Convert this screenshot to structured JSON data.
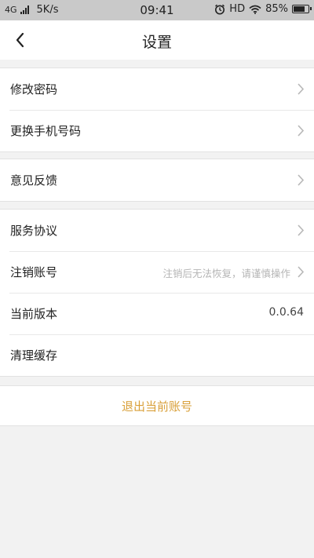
{
  "status_bar": {
    "network": "4G",
    "speed": "5K/s",
    "time": "09:41",
    "indicator": "HD",
    "battery": "85%",
    "battery_level": 0.85
  },
  "nav": {
    "title": "设置",
    "back_icon": "chevron-left-icon"
  },
  "groups": [
    {
      "items": [
        {
          "label": "修改密码",
          "chevron": true
        },
        {
          "label": "更换手机号码",
          "chevron": true
        }
      ]
    },
    {
      "items": [
        {
          "label": "意见反馈",
          "chevron": true
        }
      ]
    },
    {
      "items": [
        {
          "label": "服务协议",
          "chevron": true
        },
        {
          "label": "注销账号",
          "hint": "注销后无法恢复，请谨慎操作",
          "chevron": true
        },
        {
          "label": "当前版本",
          "value": "0.0.64"
        },
        {
          "label": "清理缓存"
        }
      ]
    }
  ],
  "logout": {
    "label": "退出当前账号",
    "color": "#d9a03a"
  }
}
